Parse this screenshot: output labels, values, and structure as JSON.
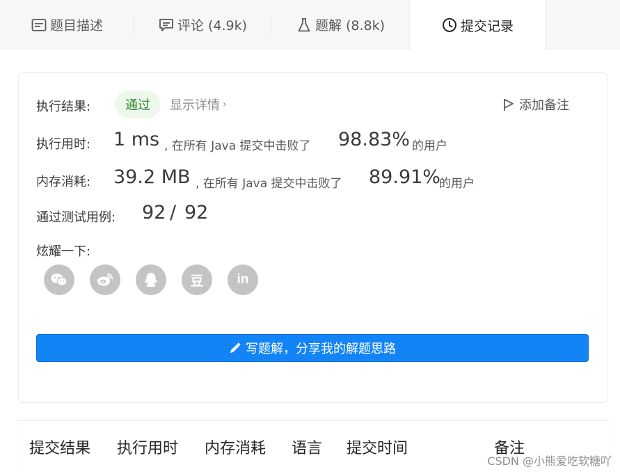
{
  "tabs": [
    {
      "label": "题目描述",
      "icon": "description-icon"
    },
    {
      "label": "评论 (4.9k)",
      "icon": "comment-icon"
    },
    {
      "label": "题解 (8.8k)",
      "icon": "flask-icon"
    },
    {
      "label": "提交记录",
      "icon": "clock-icon",
      "active": true
    }
  ],
  "result": {
    "label": "执行结果:",
    "status": "通过",
    "detail_link": "显示详情",
    "add_note": "添加备注"
  },
  "runtime": {
    "label": "执行用时:",
    "value": "1 ms",
    "middle_text": ", 在所有 Java 提交中击败了",
    "percent": "98.83%",
    "suffix": "的用户"
  },
  "memory": {
    "label": "内存消耗:",
    "value": "39.2 MB",
    "middle_text": ", 在所有 Java 提交中击败了",
    "percent": "89.91%",
    "suffix": "的用户"
  },
  "tests": {
    "label": "通过测试用例:",
    "passed": "92",
    "separator": "/",
    "total": "92"
  },
  "share": {
    "label": "炫耀一下:",
    "icons": [
      "wechat-icon",
      "weibo-icon",
      "qq-icon",
      "douban-icon",
      "linkedin-icon"
    ],
    "douban_glyph": "豆",
    "linkedin_glyph": "in"
  },
  "write_button": "写题解，分享我的解题思路",
  "table_headers": [
    "提交结果",
    "执行用时",
    "内存消耗",
    "语言",
    "提交时间",
    "备注"
  ],
  "watermark": "CSDN @小熊爱吃软糖吖",
  "colors": {
    "accent": "#1284f6",
    "pass_bg": "#eef7ec",
    "pass_text": "#2d8a2d",
    "share_icon": "#c4c4c4"
  }
}
